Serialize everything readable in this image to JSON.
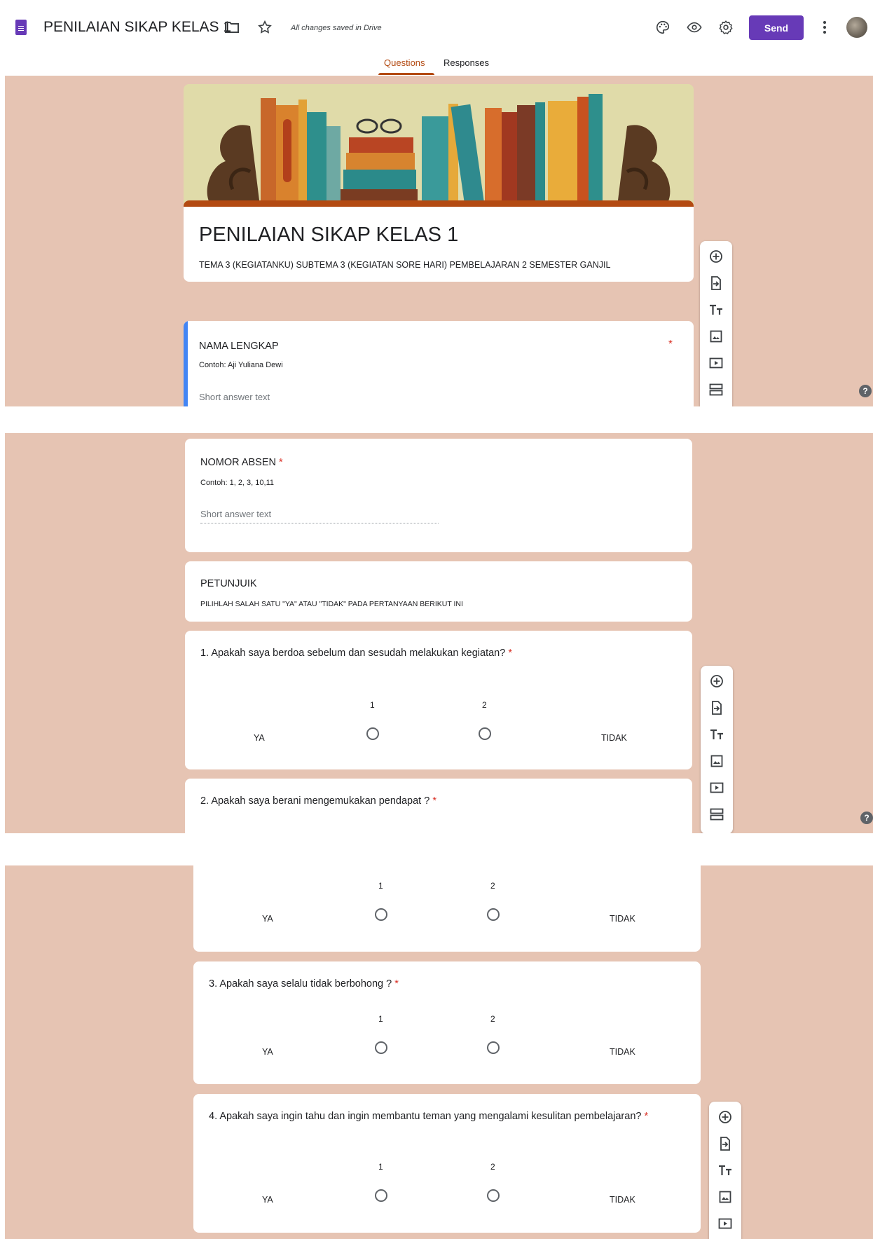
{
  "header": {
    "title": "PENILAIAN SIKAP KELAS 1",
    "saved_status": "All changes saved in Drive",
    "send_label": "Send",
    "icons": [
      "form-doc-icon",
      "folder-icon",
      "star-icon",
      "palette-icon",
      "eye-icon",
      "settings-icon",
      "more-vert-icon"
    ],
    "accent_color": "#673ab7"
  },
  "tabs": [
    {
      "label": "Questions",
      "active": true
    },
    {
      "label": "Responses",
      "active": false
    }
  ],
  "theme": {
    "background": "#e6c4b3",
    "header_bar": "#b34a12"
  },
  "form": {
    "title": "PENILAIAN SIKAP KELAS 1",
    "description": "TEMA 3 (KEGIATANKU) SUBTEMA 3 (KEGIATAN SORE HARI) PEMBELAJARAN 2 SEMESTER GANJIL"
  },
  "questions": {
    "nama": {
      "title": "NAMA LENGKAP",
      "required": "*",
      "hint": "Contoh: Aji Yuliana Dewi",
      "placeholder": "Short answer text"
    },
    "absen": {
      "title": "NOMOR ABSEN",
      "required": "*",
      "hint": "Contoh: 1, 2, 3, 10,11",
      "placeholder": "Short answer text"
    },
    "petunjuk": {
      "title": "PETUNJUIK",
      "text": "PILIHLAH SALAH SATU \"YA\" ATAU \"TIDAK\" PADA PERTANYAAN BERIKUT INI"
    },
    "q1": {
      "title": "1. Apakah saya berdoa sebelum dan sesudah melakukan kegiatan?",
      "required": "*"
    },
    "q2": {
      "title": "2. Apakah saya berani mengemukakan pendapat ?",
      "required": "*"
    },
    "q3": {
      "title": "3. Apakah saya selalu tidak berbohong ?",
      "required": "*"
    },
    "q4": {
      "title": "4. Apakah saya ingin tahu dan ingin membantu teman yang mengalami kesulitan pembelajaran?",
      "required": "*"
    }
  },
  "scale": {
    "min_label": "YA",
    "max_label": "TIDAK",
    "options": [
      "1",
      "2"
    ]
  },
  "side_tools": [
    "add-question-icon",
    "import-questions-icon",
    "add-title-icon",
    "add-image-icon",
    "add-video-icon",
    "add-section-icon"
  ],
  "help_label": "?"
}
